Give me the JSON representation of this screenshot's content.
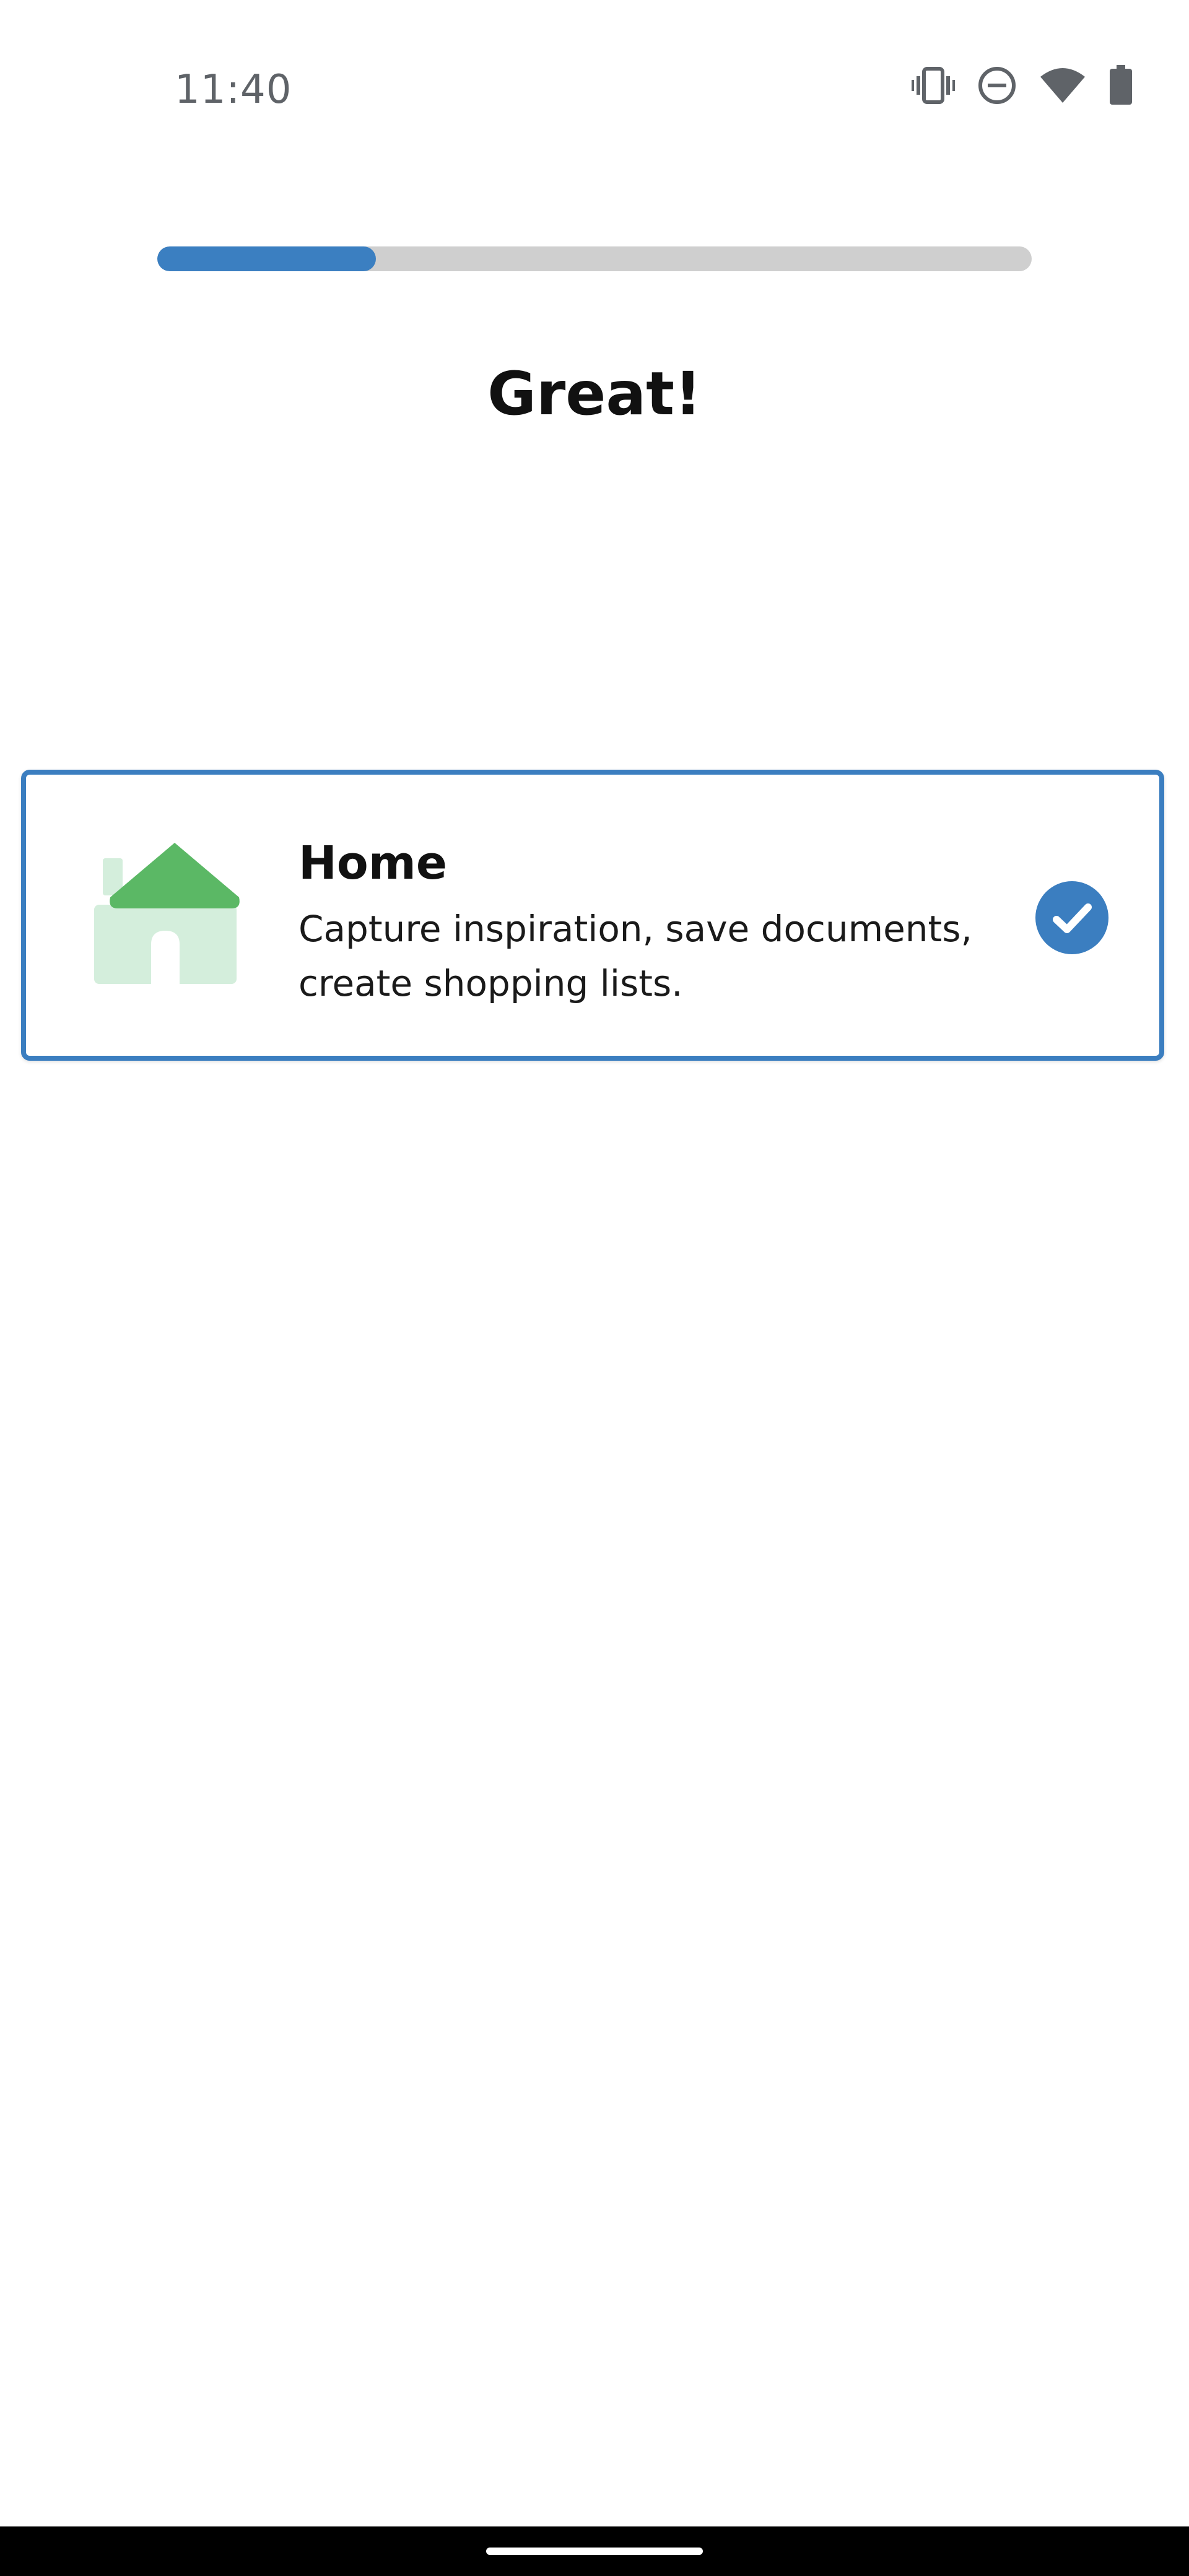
{
  "status_bar": {
    "time": "11:40",
    "icons": [
      "vibrate-icon",
      "do-not-disturb-icon",
      "wifi-icon",
      "battery-icon"
    ]
  },
  "progress": {
    "fraction": 0.25,
    "color": "#3b7fc1",
    "track_color": "#cfcfcf"
  },
  "title": "Great!",
  "option": {
    "icon": "house-icon",
    "title": "Home",
    "description": "Capture inspiration, save documents, create shopping lists.",
    "selected": true,
    "accent_color": "#3b7ec0"
  }
}
